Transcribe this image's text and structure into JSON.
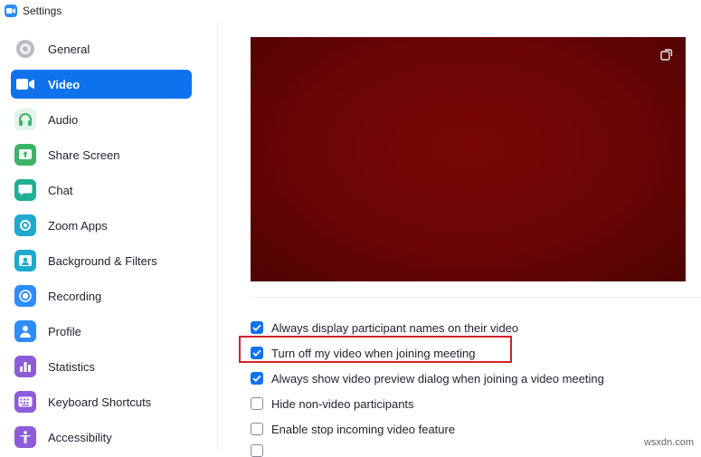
{
  "window": {
    "title": "Settings"
  },
  "sidebar": {
    "items": [
      {
        "label": "General",
        "icon": "gear-icon",
        "color": "#9fa3ab",
        "active": false
      },
      {
        "label": "Video",
        "icon": "video-camera-icon",
        "color": "#ffffff",
        "active": true
      },
      {
        "label": "Audio",
        "icon": "headphones-icon",
        "color": "#3db367",
        "active": false
      },
      {
        "label": "Share Screen",
        "icon": "share-screen-icon",
        "color": "#3db367",
        "active": false
      },
      {
        "label": "Chat",
        "icon": "chat-bubble-icon",
        "color": "#1fae94",
        "active": false
      },
      {
        "label": "Zoom Apps",
        "icon": "apps-icon",
        "color": "#1fa9cf",
        "active": false
      },
      {
        "label": "Background & Filters",
        "icon": "background-filters-icon",
        "color": "#1fa9cf",
        "active": false
      },
      {
        "label": "Recording",
        "icon": "record-icon",
        "color": "#2d8cff",
        "active": false
      },
      {
        "label": "Profile",
        "icon": "person-icon",
        "color": "#2d8cff",
        "active": false
      },
      {
        "label": "Statistics",
        "icon": "bar-chart-icon",
        "color": "#8d5cd8",
        "active": false
      },
      {
        "label": "Keyboard Shortcuts",
        "icon": "keyboard-icon",
        "color": "#8d5cd8",
        "active": false
      },
      {
        "label": "Accessibility",
        "icon": "accessibility-icon",
        "color": "#8d5cd8",
        "active": false
      }
    ]
  },
  "video": {
    "preview_toggle_icon": "rotate-camera-icon",
    "options": [
      {
        "label": "Always display participant names on their video",
        "checked": true
      },
      {
        "label": "Turn off my video when joining meeting",
        "checked": true,
        "highlighted": true
      },
      {
        "label": "Always show video preview dialog when joining a video meeting",
        "checked": true
      },
      {
        "label": "Hide non-video participants",
        "checked": false
      },
      {
        "label": "Enable stop incoming video feature",
        "checked": false
      }
    ]
  },
  "watermark": "wsxdn.com",
  "colors": {
    "accent": "#0e72ed",
    "highlight_box": "#d2222a",
    "preview_bg": "#6a0505"
  }
}
